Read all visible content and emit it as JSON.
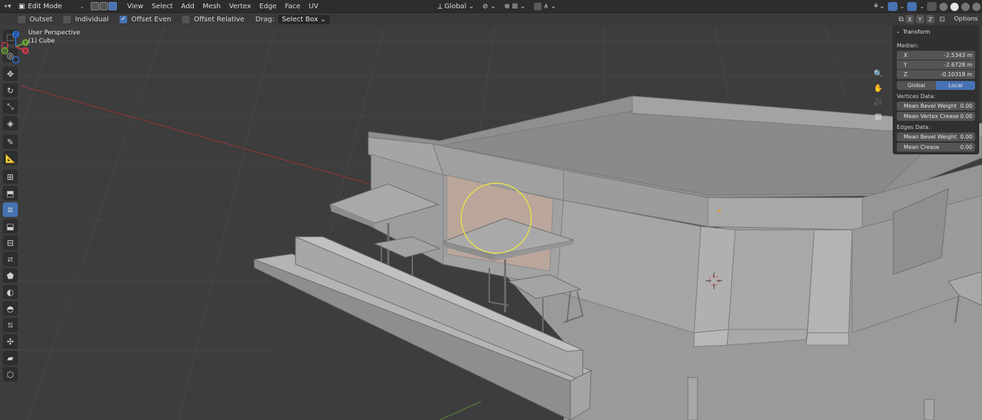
{
  "header": {
    "mode_label": "Edit Mode",
    "menus": [
      "View",
      "Select",
      "Add",
      "Mesh",
      "Vertex",
      "Edge",
      "Face",
      "UV"
    ],
    "orientation": "Global"
  },
  "tool_settings": {
    "options": [
      {
        "label": "Outset",
        "checked": false
      },
      {
        "label": "Individual",
        "checked": false
      },
      {
        "label": "Offset Even",
        "checked": true
      },
      {
        "label": "Offset Relative",
        "checked": false
      }
    ],
    "drag_label": "Drag:",
    "drag_value": "Select Box",
    "axes": [
      "X",
      "Y",
      "Z"
    ],
    "options_label": "Options"
  },
  "viewport": {
    "view_name": "User Perspective",
    "object_name": "(1) Cube"
  },
  "gizmo": {
    "z": "Z",
    "y": "Y",
    "x": "X"
  },
  "transform_panel": {
    "title": "Transform",
    "median_label": "Median:",
    "x_label": "X",
    "x_value": "-2.5343 m",
    "y_label": "Y",
    "y_value": "-2.6728 m",
    "z_label": "Z",
    "z_value": "-0.10318 m",
    "space_global": "Global",
    "space_local": "Local",
    "vertices_label": "Vertices Data:",
    "v_bevel_label": "Mean Bevel Weight",
    "v_bevel_value": "0.00",
    "v_crease_label": "Mean Vertex Crease",
    "v_crease_value": "0.00",
    "edges_label": "Edges Data:",
    "e_bevel_label": "Mean Bevel Weight",
    "e_bevel_value": "0.00",
    "e_crease_label": "Mean Crease",
    "e_crease_value": "0.00"
  },
  "colors": {
    "accent": "#4772b3",
    "brush_circle": "#e8e24a",
    "selection_face": "#c4a898"
  }
}
